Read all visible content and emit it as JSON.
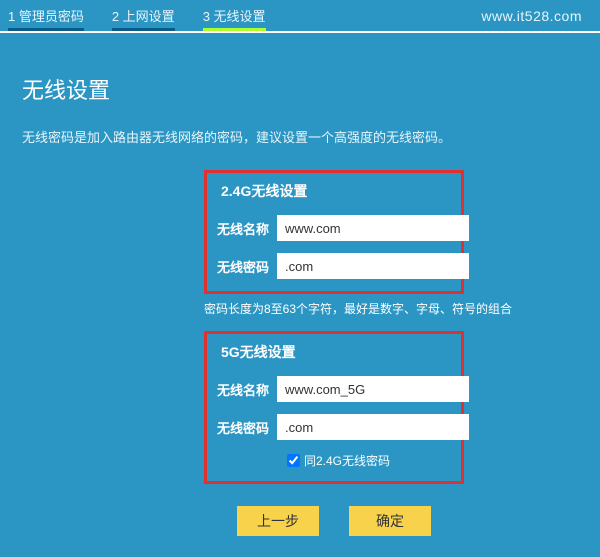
{
  "watermark": "www.it528.com",
  "steps": [
    {
      "label": "1 管理员密码",
      "active": false,
      "color": "blue"
    },
    {
      "label": "2 上网设置",
      "active": false,
      "color": "blue"
    },
    {
      "label": "3 无线设置",
      "active": true,
      "color": "green"
    }
  ],
  "page": {
    "title": "无线设置",
    "hint": "无线密码是加入路由器无线网络的密码，建议设置一个高强度的无线密码。"
  },
  "group_24g": {
    "title": "2.4G无线设置",
    "name_label": "无线名称",
    "name_value": "www.com",
    "pw_label": "无线密码",
    "pw_value": ".com"
  },
  "pw_hint": "密码长度为8至63个字符，最好是数字、字母、符号的组合",
  "group_5g": {
    "title": "5G无线设置",
    "name_label": "无线名称",
    "name_value": "www.com_5G",
    "pw_label": "无线密码",
    "pw_value": ".com",
    "same_label": "同2.4G无线密码",
    "same_checked": true
  },
  "buttons": {
    "prev": "上一步",
    "confirm": "确定"
  }
}
